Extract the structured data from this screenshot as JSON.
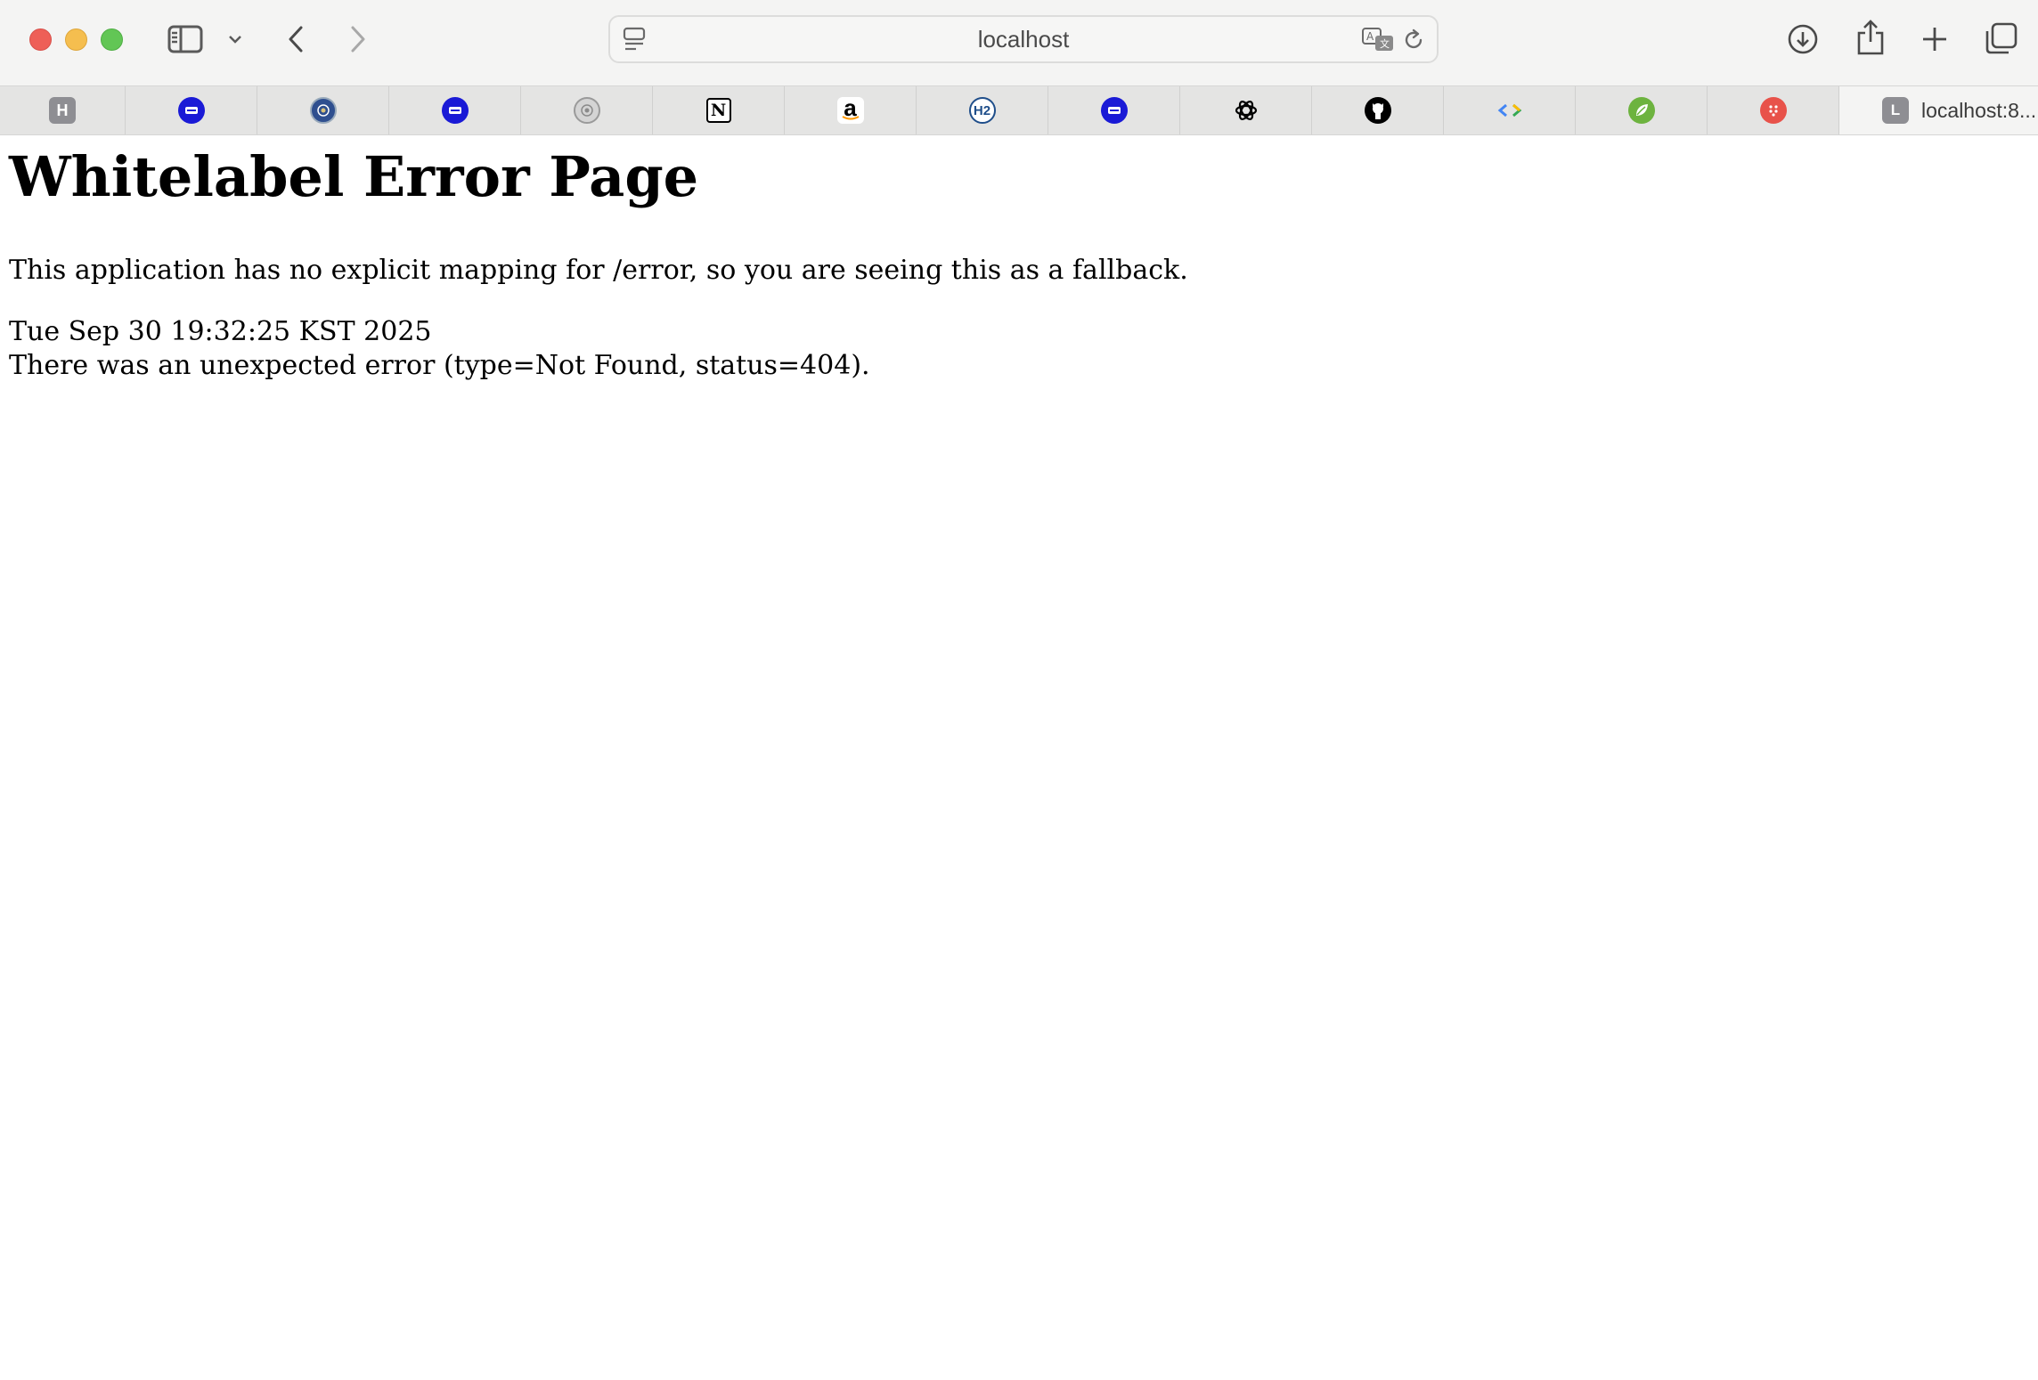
{
  "browser": {
    "address": "localhost",
    "active_tab": {
      "title": "localhost:8...",
      "favicon_letter": "L"
    },
    "pinned_tabs": [
      {
        "icon": "h-letter-icon",
        "letter": "H",
        "color": "#8e8e93"
      },
      {
        "icon": "blue-card-icon",
        "color": "#1a1ad6"
      },
      {
        "icon": "seal-icon",
        "color": "#2f4f8f"
      },
      {
        "icon": "blue-card-icon",
        "color": "#1a1ad6"
      },
      {
        "icon": "grey-seal-icon",
        "color": "#9a9a9a"
      },
      {
        "icon": "notion-icon",
        "letter": "N",
        "color": "#000000"
      },
      {
        "icon": "amazon-icon",
        "letter": "a",
        "color": "#000000"
      },
      {
        "icon": "h2-icon",
        "letter": "H2",
        "color": "#1f4e8a"
      },
      {
        "icon": "blue-card-icon",
        "color": "#1a1ad6"
      },
      {
        "icon": "openai-icon",
        "color": "#000000"
      },
      {
        "icon": "github-icon",
        "color": "#000000"
      },
      {
        "icon": "code-brackets-icon",
        "color": "#4285f4"
      },
      {
        "icon": "spring-leaf-icon",
        "color": "#6db33f"
      },
      {
        "icon": "red-dots-icon",
        "color": "#e8524a"
      }
    ]
  },
  "page": {
    "heading": "Whitelabel Error Page",
    "message": "This application has no explicit mapping for /error, so you are seeing this as a fallback.",
    "timestamp": "Tue Sep 30 19:32:25 KST 2025",
    "error": "There was an unexpected error (type=Not Found, status=404)."
  }
}
